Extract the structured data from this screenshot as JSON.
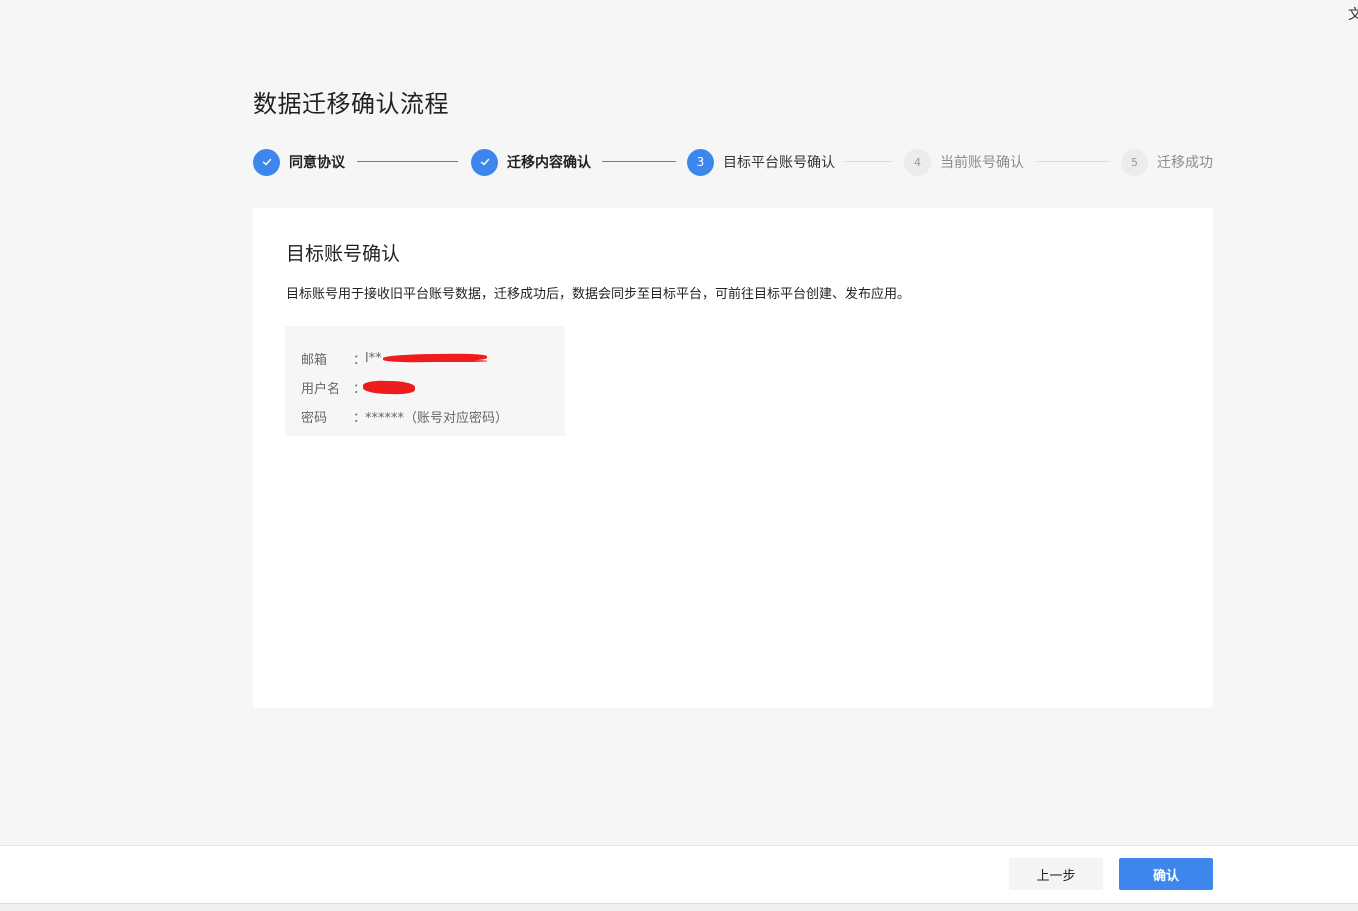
{
  "corner": {
    "glyph": "文"
  },
  "page": {
    "title": "数据迁移确认流程"
  },
  "steps": [
    {
      "index": "1",
      "label": "同意协议",
      "status": "done"
    },
    {
      "index": "2",
      "label": "迁移内容确认",
      "status": "done"
    },
    {
      "index": "3",
      "label": "目标平台账号确认",
      "status": "active"
    },
    {
      "index": "4",
      "label": "当前账号确认",
      "status": "pending"
    },
    {
      "index": "5",
      "label": "迁移成功",
      "status": "pending"
    }
  ],
  "card": {
    "title": "目标账号确认",
    "description": "目标账号用于接收旧平台账号数据，迁移成功后，数据会同步至目标平台，可前往目标平台创建、发布应用。",
    "fields": [
      {
        "key": "邮箱",
        "colon": "：",
        "value": "l**"
      },
      {
        "key": "用户名",
        "colon": "：",
        "value": ""
      },
      {
        "key": "密码",
        "colon": "：",
        "value": "******（账号对应密码）"
      }
    ]
  },
  "footer": {
    "prev_label": "上一步",
    "confirm_label": "确认"
  },
  "colors": {
    "accent": "#3d86ec",
    "background": "#f6f6f6",
    "redaction": "#ee1c1c"
  }
}
